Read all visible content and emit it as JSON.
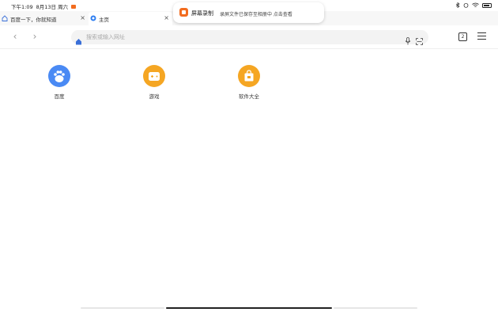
{
  "status_bar": {
    "time": "下午1:09",
    "date": "8月13日 周六",
    "battery_icon": "battery-icon",
    "wifi_icon": "wifi-icon",
    "bluetooth_icon": "bluetooth-icon"
  },
  "tabs": [
    {
      "title": "百度一下，你就知道",
      "close": "×",
      "icon": "baidu-paw-icon"
    },
    {
      "title": "主页",
      "close": "×",
      "icon": "home-circle-icon"
    }
  ],
  "notification": {
    "title": "屏幕录制",
    "text": "录屏文件已保存至相册中 点击查看",
    "icon": "screen-record-icon",
    "accent": "#f26c1f"
  },
  "toolbar": {
    "back": "‹",
    "forward": "›",
    "search_placeholder": "搜索或输入网址",
    "tabs_count": "2"
  },
  "shortcuts": [
    {
      "label": "百度",
      "icon": "baidu-paw-icon",
      "color": "#4a8af4"
    },
    {
      "label": "游戏",
      "icon": "gamepad-icon",
      "color": "#f5a623"
    },
    {
      "label": "软件大全",
      "icon": "shopping-bag-icon",
      "color": "#f5a623"
    }
  ]
}
